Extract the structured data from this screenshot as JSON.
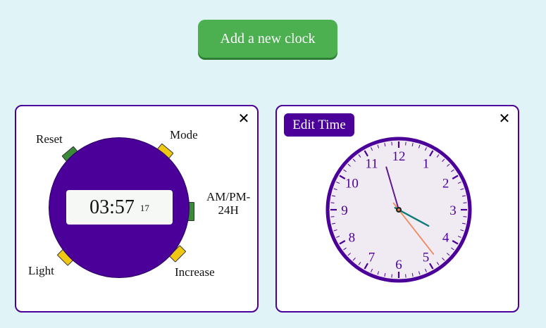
{
  "add_button": {
    "label": "Add a new clock",
    "color": "#4caf50"
  },
  "digital_clock": {
    "close_symbol": "✕",
    "buttons": {
      "reset": "Reset",
      "mode": "Mode",
      "ampm": [
        "AM/PM-",
        "24H"
      ],
      "light": "Light",
      "increase": "Increase"
    },
    "display": {
      "time": "03:57",
      "seconds": "17"
    },
    "colors": {
      "face": "#4a0099",
      "reset_button": "#3a8a3a",
      "mode_ampm_button": "#3a8a3a",
      "light_increase_button": "#f0c814"
    }
  },
  "analog_clock": {
    "close_symbol": "✕",
    "edit_button": "Edit Time",
    "numbers": [
      "12",
      "1",
      "2",
      "3",
      "4",
      "5",
      "6",
      "7",
      "8",
      "9",
      "10",
      "11"
    ],
    "time": {
      "hours": 3,
      "minutes": 57,
      "seconds": 17
    },
    "colors": {
      "numbers": "#4a0099",
      "rim": "#4a0099",
      "face": "#f0eaf2",
      "hour_hand": "#0e7c7b",
      "minute_hand": "#5c1a8c",
      "second_hand": "#f08a5d"
    }
  }
}
